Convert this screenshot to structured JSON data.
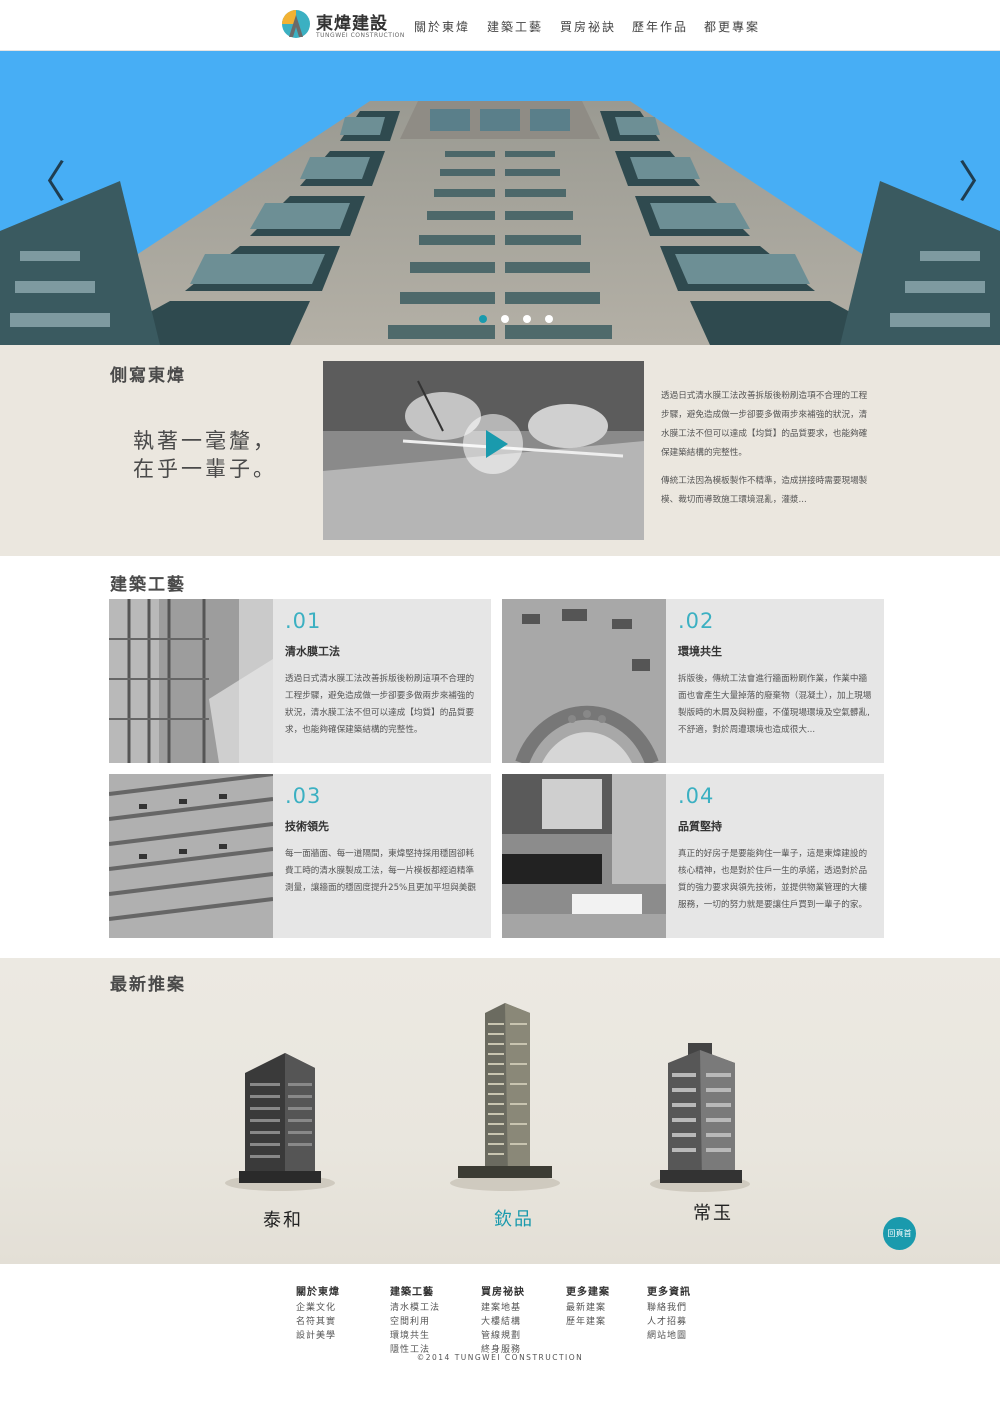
{
  "header": {
    "logo_cn": "東煒建設",
    "logo_en": "TUNGWEI CONSTRUCTION",
    "nav": [
      "關於東煒",
      "建築工藝",
      "買房祕訣",
      "歷年作品",
      "都更專案"
    ]
  },
  "hero": {
    "prev_label": "〈",
    "next_label": "〉",
    "slide_count": 4,
    "active_slide": 1
  },
  "about": {
    "title": "側寫東煒",
    "slogan_line1": "執著一毫釐，",
    "slogan_line2": "在乎一輩子。",
    "para1": "透過日式清水膜工法改善拆版後粉刷造項不合理的工程步驟，避免造成做一步卻要多做兩步來補強的狀況，清水膜工法不但可以達成【均質】的品質要求，也能夠確保建築結構的完整性。",
    "para2": "傳統工法因為模板製作不精準，造成拼接時需要現場製模、裁切而導致施工環境混亂，灌漿..."
  },
  "craft": {
    "title": "建築工藝",
    "cards": [
      {
        "num": ".01",
        "title": "清水膜工法",
        "text": "透過日式清水膜工法改善拆版後粉刷這項不合理的工程步驟，避免造成做一步卻要多做兩步來補強的狀況，清水膜工法不但可以達成【均質】的品質要求，也能夠確保建築結構的完整性。"
      },
      {
        "num": ".02",
        "title": "環境共生",
        "text": "拆版後，傳統工法會進行牆面粉刷作業，作業中牆面也會產生大量掉落的廢棄物（混凝土），加上現場製版時的木屑及與粉塵，不僅現場環境及空氣髒亂,不舒適，對於周遭環境也造成很大..."
      },
      {
        "num": ".03",
        "title": "技術領先",
        "text": "每一面牆面、每一道隔間，東煒堅持採用穩固卻耗費工時的清水膜製成工法，每一片模板都經過精準測量，讓牆面的穩固度提升25%且更加平坦與美觀"
      },
      {
        "num": ".04",
        "title": "品質堅持",
        "text": "真正的好房子是要能夠住一輩子，這是東煒建設的核心精神，也是對於住戶一生的承諾，透過對於品質的強力要求與領先技術，並提供物業管理的大樓服務，一切的努力就是要讓住戶買到一輩子的家。"
      }
    ]
  },
  "projects": {
    "title": "最新推案",
    "items": [
      {
        "name": "泰和",
        "color": "#222222"
      },
      {
        "name": "欽品",
        "color": "#1a9aad"
      },
      {
        "name": "常玉",
        "color": "#111111"
      }
    ],
    "back_to_top": "回頁首"
  },
  "footer": {
    "columns": [
      {
        "heading": "關於東煒",
        "links": [
          "企業文化",
          "名符其實",
          "設計美學"
        ]
      },
      {
        "heading": "建築工藝",
        "links": [
          "清水模工法",
          "空間利用",
          "環境共生",
          "隱性工法"
        ]
      },
      {
        "heading": "買房祕訣",
        "links": [
          "建案地基",
          "大樓結構",
          "管線規劃",
          "終身服務"
        ]
      },
      {
        "heading": "更多建案",
        "links": [
          "最新建案",
          "歷年建案"
        ]
      },
      {
        "heading": "更多資訊",
        "links": [
          "聯絡我們",
          "人才招募",
          "網站地圖"
        ]
      }
    ],
    "copyright": "©2014 TUNGWEI CONSTRUCTION"
  },
  "colors": {
    "accent": "#1a9aad",
    "sky": "#47aef5",
    "beige": "#ebe7df"
  }
}
